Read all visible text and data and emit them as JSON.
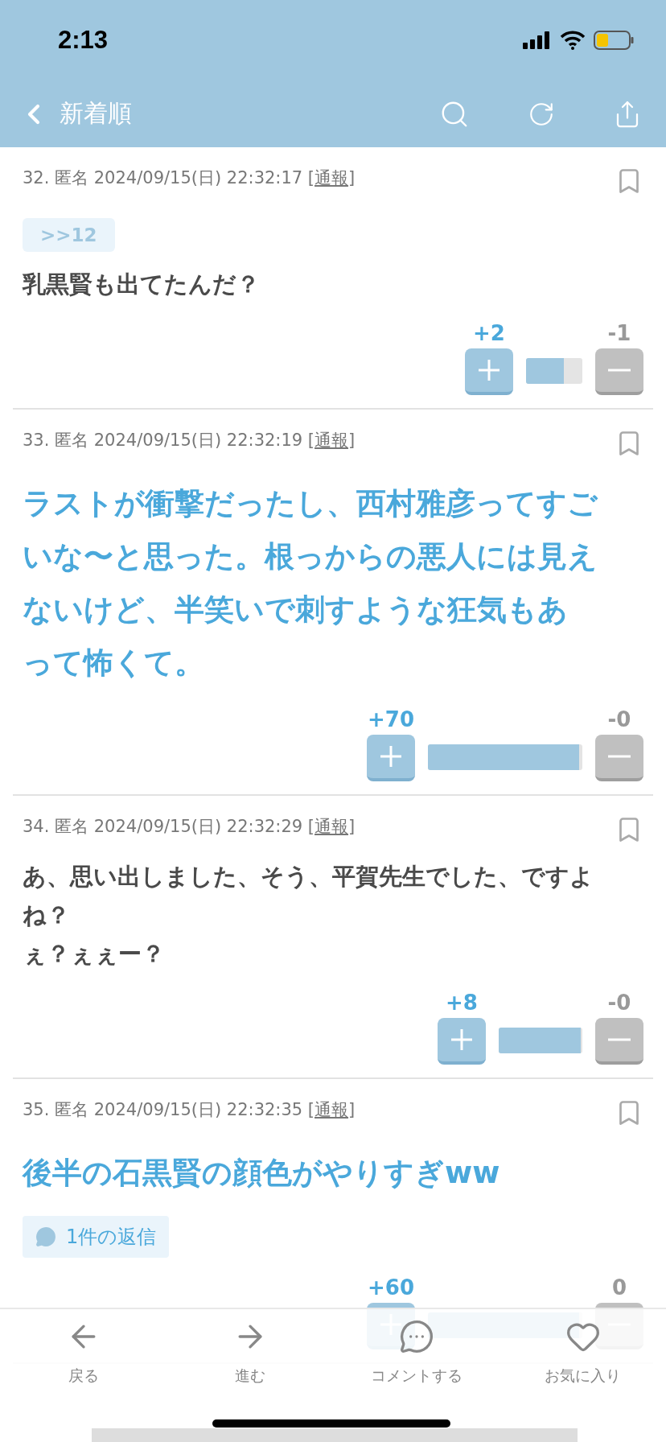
{
  "status_bar": {
    "time": "2:13"
  },
  "nav": {
    "title": "新着順"
  },
  "posts": [
    {
      "meta": "32. 匿名 2024/09/15(日) 22:32:17 [",
      "report": "通報",
      "meta_end": "]",
      "anchor": ">>12",
      "kind": "normal",
      "body": [
        "乳黒賢も出てたんだ？"
      ],
      "votes": {
        "up": "+2",
        "down": "-1",
        "level": 0.67,
        "kind": "short"
      }
    },
    {
      "meta": "33. 匿名 2024/09/15(日) 22:32:19 [",
      "report": "通報",
      "meta_end": "]",
      "kind": "popular",
      "body": [
        "ラストが衝撃だったし、西村雅彦ってすごいな〜と思った。根っからの悪人には見えないけど、半笑いで刺すような狂気もあって怖くて。"
      ],
      "votes": {
        "up": "+70",
        "down": "-0",
        "level": 0.98,
        "kind": "long"
      }
    },
    {
      "meta": "34. 匿名 2024/09/15(日) 22:32:29 [",
      "report": "通報",
      "meta_end": "]",
      "kind": "normal",
      "body": [
        "あ、思い出しました、そう、平賀先生でした、ですよね？",
        "ぇ？ぇぇー？"
      ],
      "votes": {
        "up": "+8",
        "down": "-0",
        "level": 0.98,
        "kind": "medium"
      }
    },
    {
      "meta": "35. 匿名 2024/09/15(日) 22:32:35 [",
      "report": "通報",
      "meta_end": "]",
      "kind": "popular",
      "body": [
        "後半の石黒賢の顔色がやりすぎww"
      ],
      "replies": "1件の返信",
      "votes": {
        "up": "+60",
        "down": "0",
        "level": 0.98,
        "kind": "long"
      }
    }
  ],
  "bottom_nav": [
    {
      "label": "戻る",
      "kind": "back"
    },
    {
      "label": "進む",
      "kind": "forward"
    },
    {
      "label": "コメントする",
      "kind": "comment"
    },
    {
      "label": "お気に入り",
      "kind": "favorite"
    }
  ]
}
